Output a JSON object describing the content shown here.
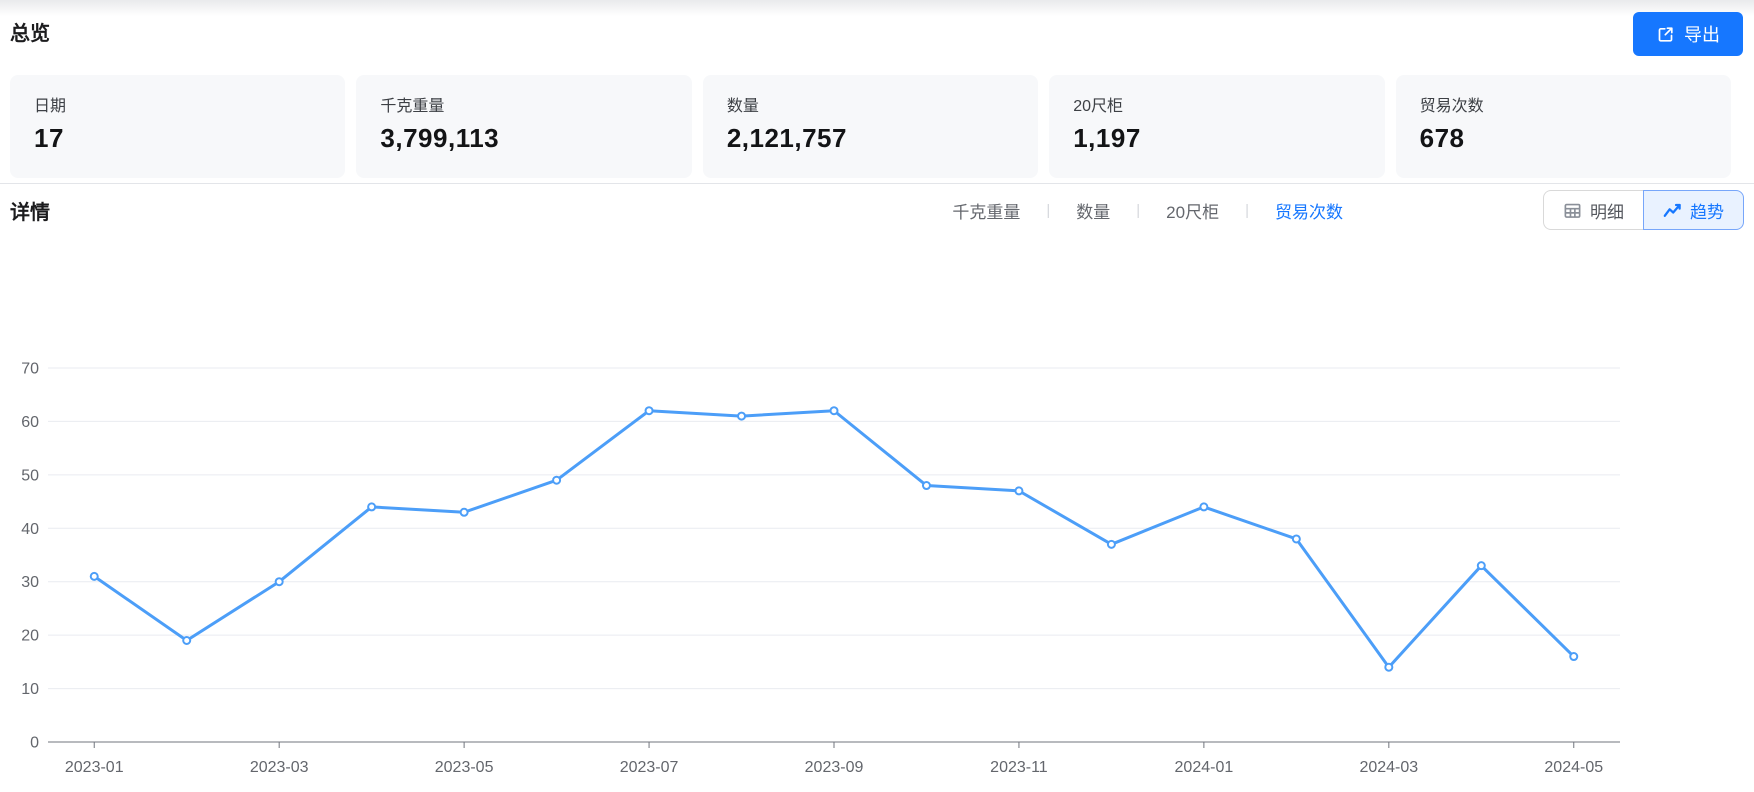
{
  "page": {
    "title": "总览",
    "details_title": "详情"
  },
  "export_button": {
    "label": "导出"
  },
  "stats": [
    {
      "label": "日期",
      "value": "17"
    },
    {
      "label": "千克重量",
      "value": "3,799,113"
    },
    {
      "label": "数量",
      "value": "2,121,757"
    },
    {
      "label": "20尺柜",
      "value": "1,197"
    },
    {
      "label": "贸易次数",
      "value": "678"
    }
  ],
  "metric_tabs": {
    "separator": "|",
    "items": [
      {
        "label": "千克重量",
        "active": false
      },
      {
        "label": "数量",
        "active": false
      },
      {
        "label": "20尺柜",
        "active": false
      },
      {
        "label": "贸易次数",
        "active": true
      }
    ]
  },
  "view_toggle": [
    {
      "label": "明细",
      "icon": "table-icon",
      "active": false
    },
    {
      "label": "趋势",
      "icon": "trend-icon",
      "active": true
    }
  ],
  "colors": {
    "primary": "#1677ff",
    "card_bg": "#f7f8fa",
    "active_toggle_bg": "#e9f2ff",
    "active_toggle_border": "#77a6fa"
  },
  "chart_data": {
    "type": "line",
    "title": "",
    "x": [
      "2023-01",
      "2023-02",
      "2023-03",
      "2023-04",
      "2023-05",
      "2023-06",
      "2023-07",
      "2023-08",
      "2023-09",
      "2023-10",
      "2023-11",
      "2023-12",
      "2024-01",
      "2024-02",
      "2024-03",
      "2024-04",
      "2024-05"
    ],
    "series": [
      {
        "name": "贸易次数",
        "values": [
          31,
          19,
          30,
          44,
          43,
          49,
          62,
          61,
          62,
          48,
          47,
          37,
          44,
          38,
          14,
          33,
          16
        ]
      }
    ],
    "xlabel_interval": 2,
    "xtick_labels_shown": [
      "2023-01",
      "2023-03",
      "2023-05",
      "2023-07",
      "2023-09",
      "2023-11",
      "2024-01",
      "2024-03",
      "2024-05"
    ],
    "ylim": [
      0,
      70
    ],
    "ytick_step": 10,
    "grid": true,
    "legend": "none",
    "marker": "empty-circle",
    "line_color": "#4C9EF8",
    "grid_color": "#e9ebf0",
    "axis_line_color": "#71757d",
    "axis_label_color": "#63666c"
  }
}
